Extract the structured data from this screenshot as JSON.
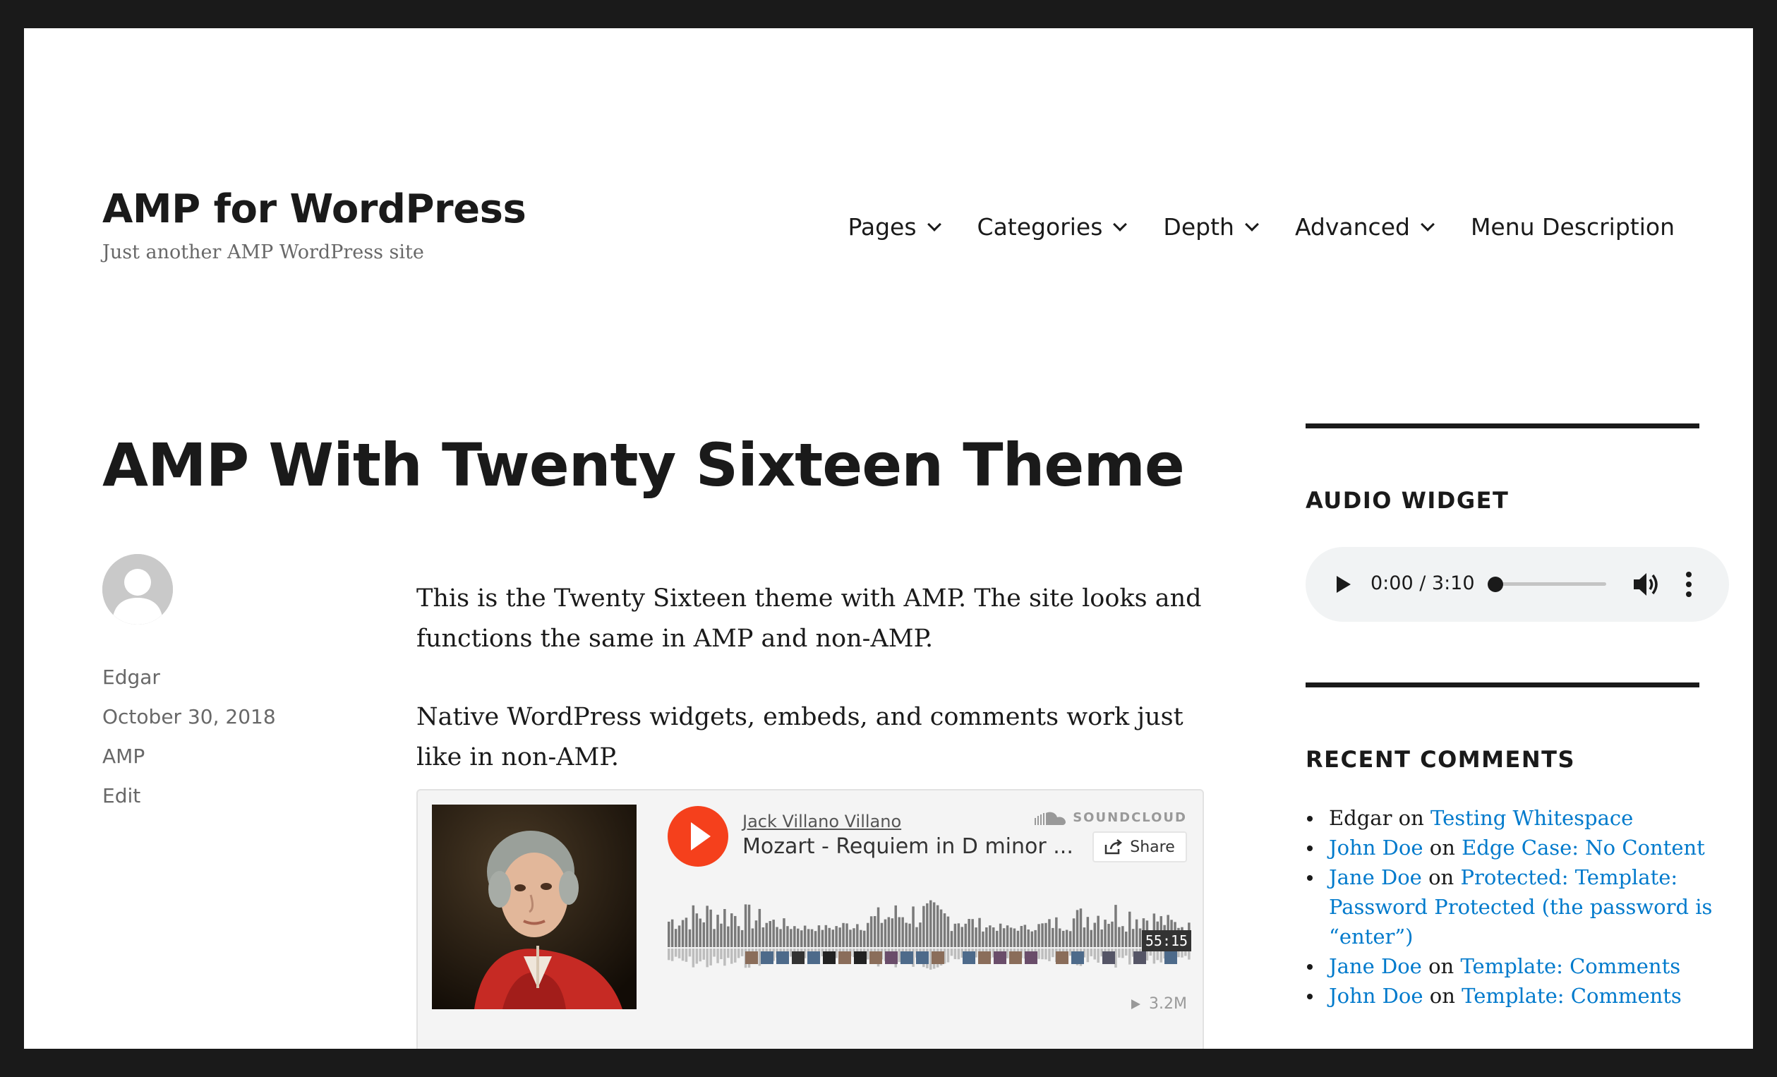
{
  "site": {
    "title": "AMP for WordPress",
    "description": "Just another AMP WordPress site"
  },
  "nav": {
    "items": [
      {
        "label": "Pages",
        "has_dropdown": true
      },
      {
        "label": "Categories",
        "has_dropdown": true
      },
      {
        "label": "Depth",
        "has_dropdown": true
      },
      {
        "label": "Advanced",
        "has_dropdown": true
      },
      {
        "label": "Menu Description",
        "has_dropdown": false
      }
    ]
  },
  "post": {
    "title": "AMP With Twenty Sixteen Theme",
    "author": "Edgar",
    "date": "October 30, 2018",
    "category": "AMP",
    "edit_label": "Edit",
    "paragraphs": [
      "This is the Twenty Sixteen theme with AMP. The site looks and functions the same in AMP and non-AMP.",
      "Native WordPress widgets, embeds, and comments work just like in non-AMP."
    ]
  },
  "soundcloud": {
    "artist": "Jack Villano Villano",
    "track": "Mozart - Requiem in D minor ...",
    "logo_text": "SOUNDCLOUD",
    "share_label": "Share",
    "duration": "55:15",
    "plays": "3.2M",
    "brand_color": "#f5401c"
  },
  "sidebar": {
    "audio_widget": {
      "title": "AUDIO WIDGET",
      "time": "0:00 / 3:10",
      "progress": 0
    },
    "recent_comments": {
      "title": "RECENT COMMENTS",
      "on_word": "on",
      "items": [
        {
          "author": "Edgar",
          "author_is_link": false,
          "post": "Testing Whitespace"
        },
        {
          "author": "John Doe",
          "author_is_link": true,
          "post": "Edge Case: No Content"
        },
        {
          "author": "Jane Doe",
          "author_is_link": true,
          "post": "Protected: Template: Password Protected (the password is “enter”)"
        },
        {
          "author": "Jane Doe",
          "author_is_link": true,
          "post": "Template: Comments"
        },
        {
          "author": "John Doe",
          "author_is_link": true,
          "post": "Template: Comments"
        }
      ]
    }
  },
  "colors": {
    "link": "#007acc",
    "text": "#1a1a1a",
    "muted": "#686868",
    "frame": "#1a1a1a"
  }
}
